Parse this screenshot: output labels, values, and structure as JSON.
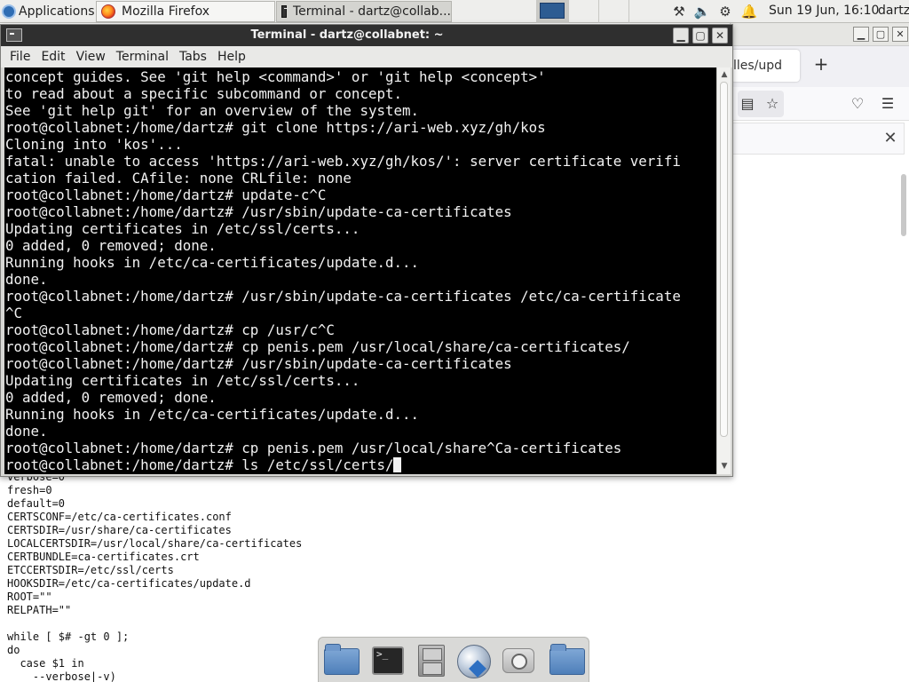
{
  "panel": {
    "applications_label": "Applications",
    "tasks": [
      {
        "label": "Mozilla Firefox"
      },
      {
        "label": "Terminal - dartz@collab..."
      }
    ],
    "clock": "Sun 19 Jun, 16:10",
    "user": "dartz"
  },
  "firefox": {
    "tab_label": "lles/upd",
    "new_tab_label": "+",
    "find_close_label": "✕"
  },
  "terminal": {
    "title": "Terminal - dartz@collabnet: ~",
    "menu": [
      "File",
      "Edit",
      "View",
      "Terminal",
      "Tabs",
      "Help"
    ],
    "lines": [
      "concept guides. See 'git help <command>' or 'git help <concept>'",
      "to read about a specific subcommand or concept.",
      "See 'git help git' for an overview of the system.",
      "root@collabnet:/home/dartz# git clone https://ari-web.xyz/gh/kos",
      "Cloning into 'kos'...",
      "fatal: unable to access 'https://ari-web.xyz/gh/kos/': server certificate verifi",
      "cation failed. CAfile: none CRLfile: none",
      "root@collabnet:/home/dartz# update-c^C",
      "root@collabnet:/home/dartz# /usr/sbin/update-ca-certificates",
      "Updating certificates in /etc/ssl/certs...",
      "0 added, 0 removed; done.",
      "Running hooks in /etc/ca-certificates/update.d...",
      "done.",
      "root@collabnet:/home/dartz# /usr/sbin/update-ca-certificates /etc/ca-certificate",
      "^C",
      "root@collabnet:/home/dartz# cp /usr/c^C",
      "root@collabnet:/home/dartz# cp penis.pem /usr/local/share/ca-certificates/",
      "root@collabnet:/home/dartz# /usr/sbin/update-ca-certificates",
      "Updating certificates in /etc/ssl/certs...",
      "0 added, 0 removed; done.",
      "Running hooks in /etc/ca-certificates/update.d...",
      "done.",
      "root@collabnet:/home/dartz# cp penis.pem /usr/local/share^Ca-certificates"
    ],
    "prompt_line": "root@collabnet:/home/dartz# ls /etc/ssl/certs/"
  },
  "background_code": {
    "lines": [
      "verbose=0",
      "fresh=0",
      "default=0",
      "CERTSCONF=/etc/ca-certificates.conf",
      "CERTSDIR=/usr/share/ca-certificates",
      "LOCALCERTSDIR=/usr/local/share/ca-certificates",
      "CERTBUNDLE=ca-certificates.crt",
      "ETCCERTSDIR=/etc/ssl/certs",
      "HOOKSDIR=/etc/ca-certificates/update.d",
      "ROOT=\"\"",
      "RELPATH=\"\"",
      "",
      "while [ $# -gt 0 ];",
      "do",
      "  case $1 in",
      "    --verbose|-v)"
    ]
  },
  "dock": {
    "terminal_glyph": ">_"
  },
  "colors": {
    "terminal_background": "#000000",
    "terminal_text": "#f2f2f2",
    "panel_background": "#eeeeec",
    "titlebar": "#2f2f2f"
  }
}
